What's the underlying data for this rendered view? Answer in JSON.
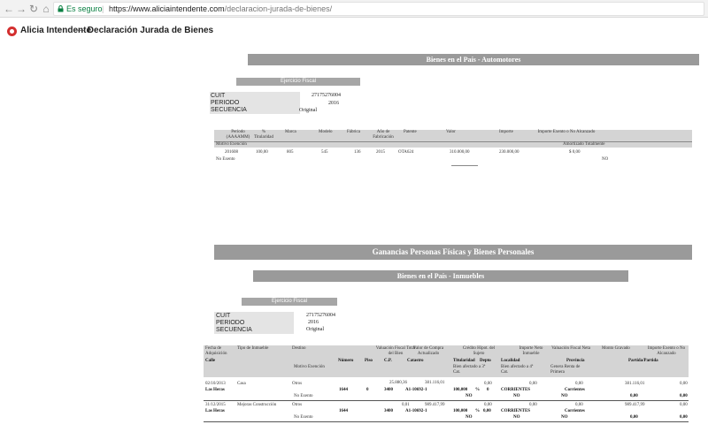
{
  "browser": {
    "secure_label": "Es seguro",
    "url_host": "https://www.aliciaintendente.com",
    "url_path": "/declaracion-jurada-de-bienes/"
  },
  "header": {
    "brand": "Alicia Intendente",
    "separator": "—",
    "title": "Declaración Jurada de Bienes"
  },
  "automotores": {
    "title": "Bienes en el País - Automotores",
    "ejercicio": "Ejercicio Fiscal",
    "cuit_label": "CUIT",
    "cuit": "27175276004",
    "periodo_label": "PERIODO",
    "periodo": "2016",
    "secuencia_label": "SECUENCIA",
    "secuencia": "Original",
    "headers": {
      "periodo": "Período (AAAAMM)",
      "titularidad": "% Titularidad",
      "marca": "Marca",
      "modelo": "Modelo",
      "fabrica": "Fábrica",
      "anio": "Año de Fabricación",
      "patente": "Patente",
      "valor": "Valor",
      "importe": "Importe",
      "exento": "Importe Exento o No Alcanzado",
      "motivo": "Motivo Exención",
      "amortizado": "Amortizado Totalmente"
    },
    "row": {
      "periodo": "201608",
      "titularidad": "100,00",
      "marca": "805",
      "modelo": "545",
      "fabrica": "136",
      "anio": "2015",
      "patente": "OTA624",
      "valor": "310.000,00",
      "importe": "230.000,00",
      "exento": "$ 0,00",
      "motivo": "No Exento",
      "amortizado": "NO"
    }
  },
  "ganancias": {
    "title": "Ganancias Personas Físicas y Bienes Personales"
  },
  "inmuebles": {
    "title": "Bienes en el País - Inmuebles",
    "ejercicio": "Ejercicio Fiscal",
    "cuit_label": "CUIT",
    "cuit": "27175276004",
    "periodo_label": "PERIODO",
    "periodo": "2016",
    "secuencia_label": "SECUENCIA",
    "secuencia": "Original",
    "headers": {
      "fecha": "Fecha de Adquisición",
      "calle": "Calle",
      "tipo": "Tipo de Inmueble",
      "destino": "Destino",
      "motivo": "Motivo Exención",
      "numero": "Número",
      "piso": "Piso",
      "cp": "C.P.",
      "valuacion": "Valuación Fiscal Total del Bien",
      "valor_compra": "Valor de Compra Actualizado",
      "catastro": "Catastro",
      "credito": "Crédito Hipot. del Sujeto",
      "titularidad": "Titularidad",
      "depto": "Depto",
      "bien_afectado": "Bien afectado a 3ª Cat.",
      "importe_neto": "Importe Neto Inmueble",
      "localidad": "Localidad",
      "bien_afectado4": "Bien afectado a 4ª Cat.",
      "valuacion_neta": "Valuación Fiscal Neta",
      "provincia": "Provincia",
      "genera": "Genera Renta de Primera",
      "monto": "Monto Gravado",
      "partida": "Partida",
      "exento": "Importe Exento o No Alcanzado",
      "partida2": "Partida/Partida"
    },
    "rows": [
      {
        "fecha": "02/10/2013",
        "tipo": "Casa",
        "destino": "Otros",
        "valuacion": "25.880,36",
        "valor_compra": "381.116,01",
        "credito": "0,00",
        "importe_neto": "0,00",
        "valuacion_neta": "0,00",
        "monto": "381.116,01",
        "exento": "0,00",
        "calle": "Las Heras",
        "numero": "1644",
        "piso": "0",
        "cp": "3400",
        "catastro": "A1-10692-1",
        "titularidad": "100,000",
        "pct": "%",
        "depto": "0",
        "localidad": "CORRIENTES",
        "provincia": "Corrientes",
        "monto2": "0,00",
        "exento2": "0,00",
        "motivo": "No Exento",
        "afectado": "NO",
        "afectado4": "NO",
        "genera": "NO"
      },
      {
        "fecha": "31/12/2015",
        "tipo": "Mejoras Construcción",
        "destino": "Otros",
        "valuacion": "0,01",
        "valor_compra": "989.417,99",
        "credito": "0,00",
        "importe_neto": "0,00",
        "valuacion_neta": "0,00",
        "monto": "989.417,99",
        "exento": "0,00",
        "calle": "Las Heras",
        "numero": "1644",
        "piso": "",
        "cp": "3400",
        "catastro": "A1-10692-1",
        "titularidad": "100,000",
        "pct": "%",
        "depto": "0,00",
        "localidad": "CORRIENTES",
        "provincia": "Corrientes",
        "monto2": "0,00",
        "exento2": "0,00",
        "motivo": "No Exento",
        "afectado": "NO",
        "afectado4": "NO",
        "genera": "NO"
      }
    ]
  }
}
